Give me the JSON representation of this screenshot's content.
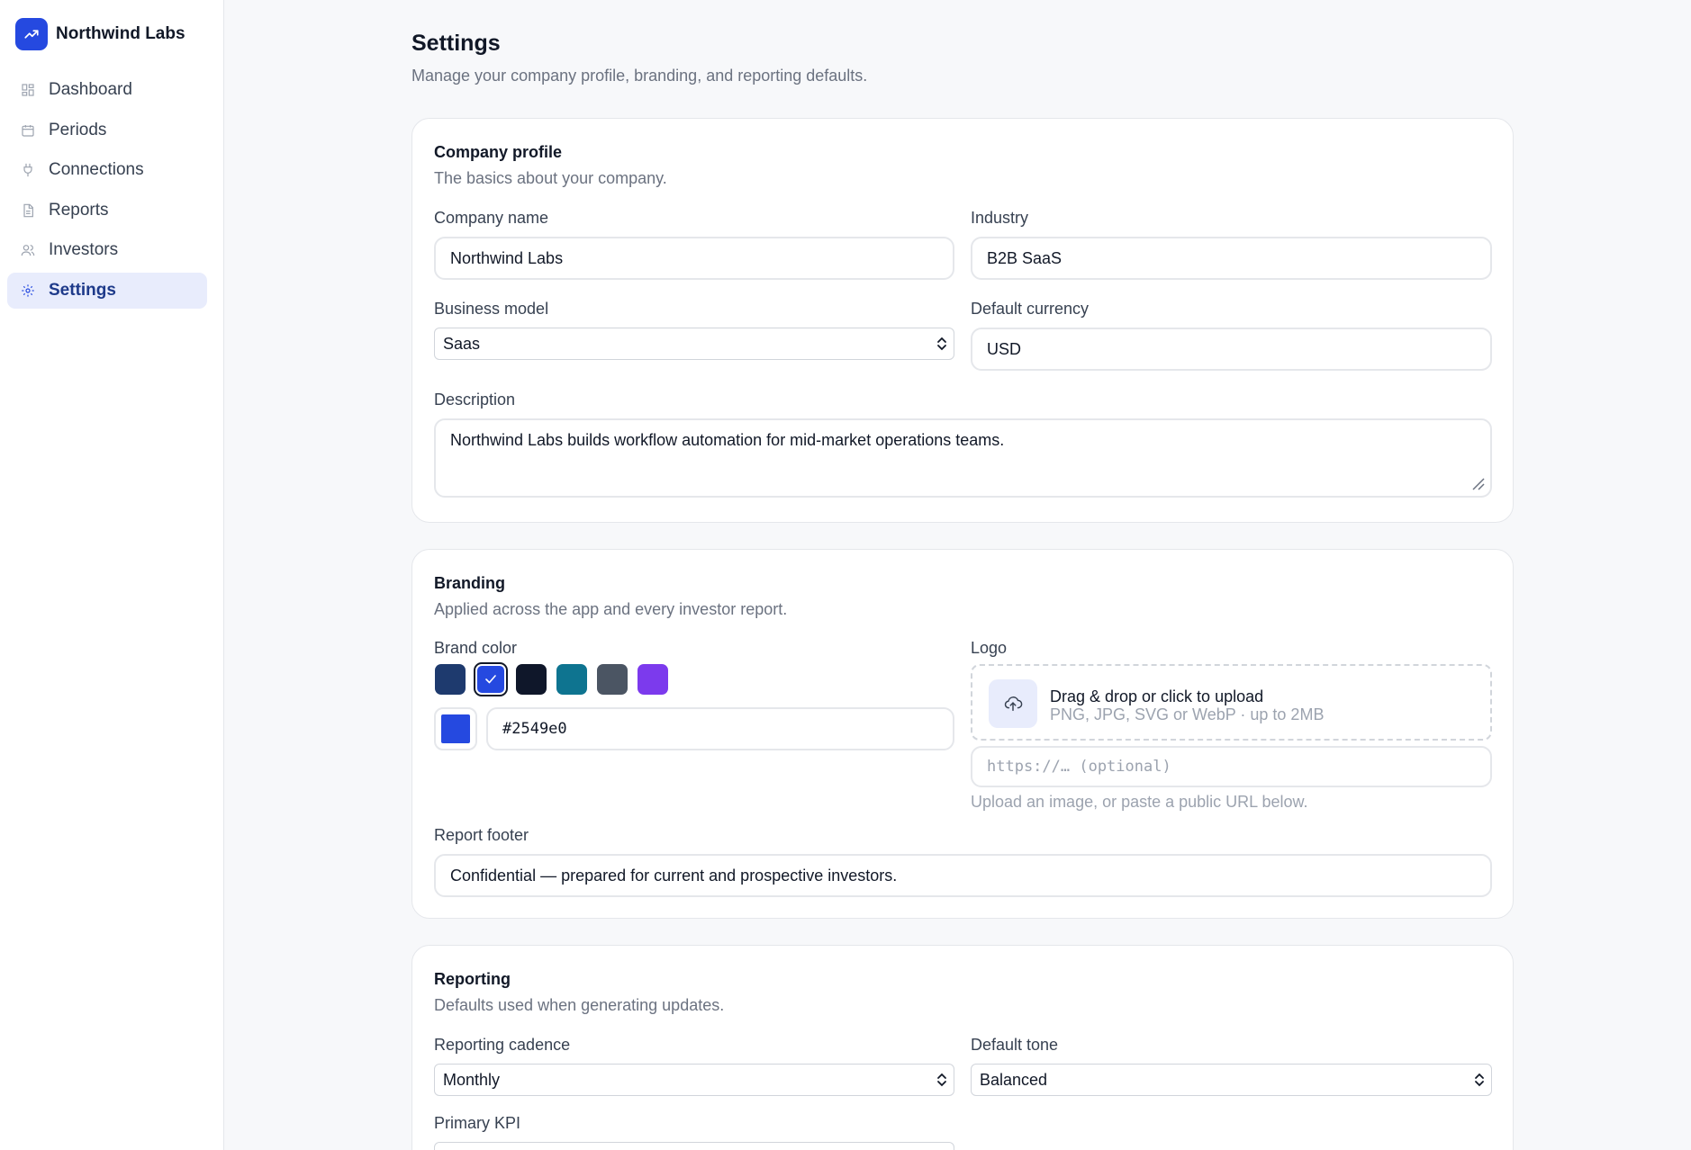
{
  "app": {
    "name": "Northwind Labs"
  },
  "sidebar": {
    "items": [
      {
        "label": "Dashboard",
        "icon": "grid-icon"
      },
      {
        "label": "Periods",
        "icon": "calendar-icon"
      },
      {
        "label": "Connections",
        "icon": "plug-icon"
      },
      {
        "label": "Reports",
        "icon": "document-icon"
      },
      {
        "label": "Investors",
        "icon": "users-icon"
      },
      {
        "label": "Settings",
        "icon": "gear-icon",
        "active": true
      }
    ]
  },
  "page": {
    "title": "Settings",
    "subtitle": "Manage your company profile, branding, and reporting defaults."
  },
  "company_profile": {
    "title": "Company profile",
    "subtitle": "The basics about your company.",
    "company_name_label": "Company name",
    "company_name_value": "Northwind Labs",
    "industry_label": "Industry",
    "industry_value": "B2B SaaS",
    "business_model_label": "Business model",
    "business_model_value": "Saas",
    "currency_label": "Default currency",
    "currency_value": "USD",
    "description_label": "Description",
    "description_value": "Northwind Labs builds workflow automation for mid-market operations teams."
  },
  "branding": {
    "title": "Branding",
    "subtitle": "Applied across the app and every investor report.",
    "brand_color_label": "Brand color",
    "swatches": [
      "#1e3a6e",
      "#2549e0",
      "#0f172a",
      "#0e7490",
      "#4b5563",
      "#7c3aed"
    ],
    "selected_swatch": "#2549e0",
    "hex_value": "#2549e0",
    "logo_label": "Logo",
    "dropzone_title": "Drag & drop or click to upload",
    "dropzone_sub": "PNG, JPG, SVG or WebP · up to 2MB",
    "url_placeholder": "https://… (optional)",
    "logo_help": "Upload an image, or paste a public URL below.",
    "footer_label": "Report footer",
    "footer_value": "Confidential — prepared for current and prospective investors."
  },
  "reporting": {
    "title": "Reporting",
    "subtitle": "Defaults used when generating updates.",
    "cadence_label": "Reporting cadence",
    "cadence_value": "Monthly",
    "tone_label": "Default tone",
    "tone_value": "Balanced",
    "kpi_label": "Primary KPI"
  },
  "colors": {
    "accent": "#2549e0",
    "active_bg": "#e8ecfc"
  }
}
